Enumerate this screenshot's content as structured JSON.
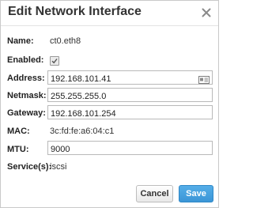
{
  "dialog": {
    "title": "Edit Network Interface"
  },
  "fields": {
    "name": {
      "label": "Name:",
      "value": "ct0.eth8"
    },
    "enabled": {
      "label": "Enabled:",
      "checked": true
    },
    "address": {
      "label": "Address:",
      "value": "192.168.101.41"
    },
    "netmask": {
      "label": "Netmask:",
      "value": "255.255.255.0"
    },
    "gateway": {
      "label": "Gateway:",
      "value": "192.168.101.254"
    },
    "mac": {
      "label": "MAC:",
      "value": "3c:fd:fe:a6:04:c1"
    },
    "mtu": {
      "label": "MTU:",
      "value": "9000"
    },
    "services": {
      "label": "Service(s):",
      "value": "iscsi"
    }
  },
  "buttons": {
    "cancel": "Cancel",
    "save": "Save"
  },
  "colors": {
    "save_button": "#3b95d6",
    "border": "#b9b9b9"
  },
  "icons": [
    "close-icon",
    "checkmark-icon",
    "contact-card-icon"
  ]
}
